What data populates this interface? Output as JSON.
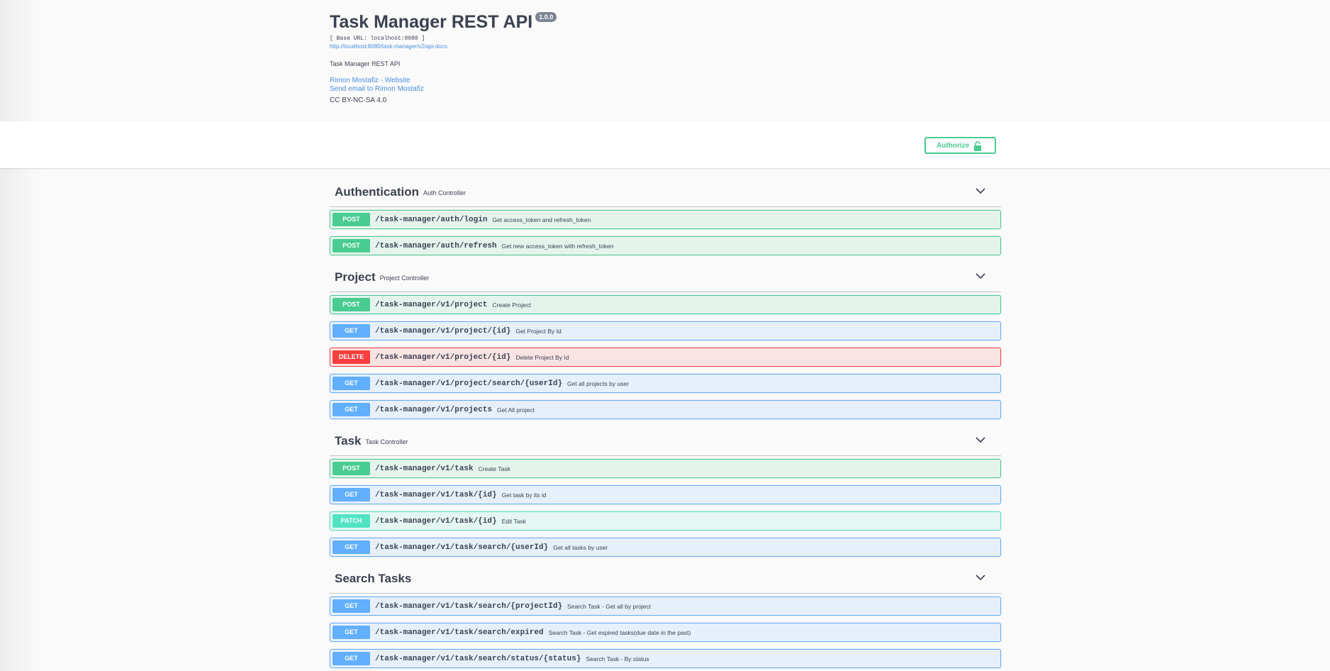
{
  "info": {
    "title": "Task Manager REST API",
    "version": "1.0.0",
    "base_url": "[ Base URL: localhost:8080 ]",
    "docs_url": "http://localhost:8080/task-manager/v2/api-docs",
    "description": "Task Manager REST API",
    "website_link": "Rimon Mostafiz - Website",
    "email_link": "Send email to Rimon Mostafiz",
    "license": "CC BY-NC-SA 4.0"
  },
  "authorize": {
    "label": "Authorize",
    "icon": "unlock-icon"
  },
  "colors": {
    "post": "#49cc90",
    "get": "#61affe",
    "delete": "#f93e3e",
    "patch": "#50e3c2"
  },
  "tags": [
    {
      "name": "Authentication",
      "description": "Auth Controller",
      "operations": [
        {
          "method": "POST",
          "path": "/task-manager/auth/login",
          "summary": "Get access_token and refresh_token"
        },
        {
          "method": "POST",
          "path": "/task-manager/auth/refresh",
          "summary": "Get new access_token with refresh_token"
        }
      ]
    },
    {
      "name": "Project",
      "description": "Project Controller",
      "operations": [
        {
          "method": "POST",
          "path": "/task-manager/v1/project",
          "summary": "Create Project"
        },
        {
          "method": "GET",
          "path": "/task-manager/v1/project/{id}",
          "summary": "Get Project By Id"
        },
        {
          "method": "DELETE",
          "path": "/task-manager/v1/project/{id}",
          "summary": "Delete Project By Id"
        },
        {
          "method": "GET",
          "path": "/task-manager/v1/project/search/{userId}",
          "summary": "Get all projects by user"
        },
        {
          "method": "GET",
          "path": "/task-manager/v1/projects",
          "summary": "Get All project"
        }
      ]
    },
    {
      "name": "Task",
      "description": "Task Controller",
      "operations": [
        {
          "method": "POST",
          "path": "/task-manager/v1/task",
          "summary": "Create Task"
        },
        {
          "method": "GET",
          "path": "/task-manager/v1/task/{id}",
          "summary": "Get task by its id"
        },
        {
          "method": "PATCH",
          "path": "/task-manager/v1/task/{id}",
          "summary": "Edit Task"
        },
        {
          "method": "GET",
          "path": "/task-manager/v1/task/search/{userId}",
          "summary": "Get all tasks by user"
        }
      ]
    },
    {
      "name": "Search Tasks",
      "description": "",
      "operations": [
        {
          "method": "GET",
          "path": "/task-manager/v1/task/search/{projectId}",
          "summary": "Search Task - Get all by project"
        },
        {
          "method": "GET",
          "path": "/task-manager/v1/task/search/expired",
          "summary": "Search Task - Get expired tasks(due date in the past)"
        },
        {
          "method": "GET",
          "path": "/task-manager/v1/task/search/status/{status}",
          "summary": "Search Task - By status"
        }
      ]
    }
  ]
}
